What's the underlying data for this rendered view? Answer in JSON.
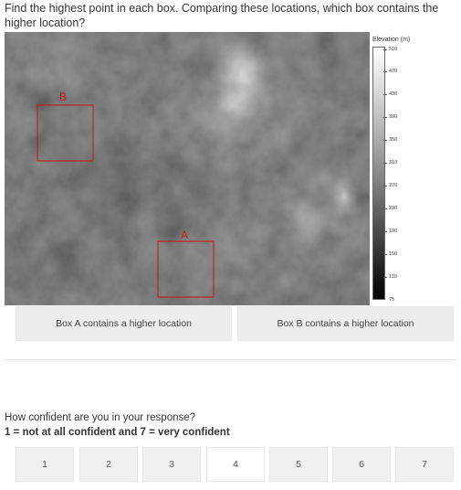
{
  "question": "Find the highest point in each box. Comparing these locations, which box contains the higher location?",
  "map": {
    "box_a_label": "A",
    "box_b_label": "B",
    "box_color": "#c0141a"
  },
  "colorbar": {
    "title": "Elevation (m)",
    "ticks": [
      "510",
      "470",
      "430",
      "390",
      "350",
      "310",
      "270",
      "230",
      "190",
      "150",
      "110",
      "75"
    ]
  },
  "choices": {
    "box_a": "Box A contains a higher location",
    "box_b": "Box B contains a higher location"
  },
  "confidence": {
    "question": "How confident are you in your response?",
    "scale_text": "1 = not at all confident and 7 = very confident",
    "options": [
      "1",
      "2",
      "3",
      "4",
      "5",
      "6",
      "7"
    ]
  }
}
